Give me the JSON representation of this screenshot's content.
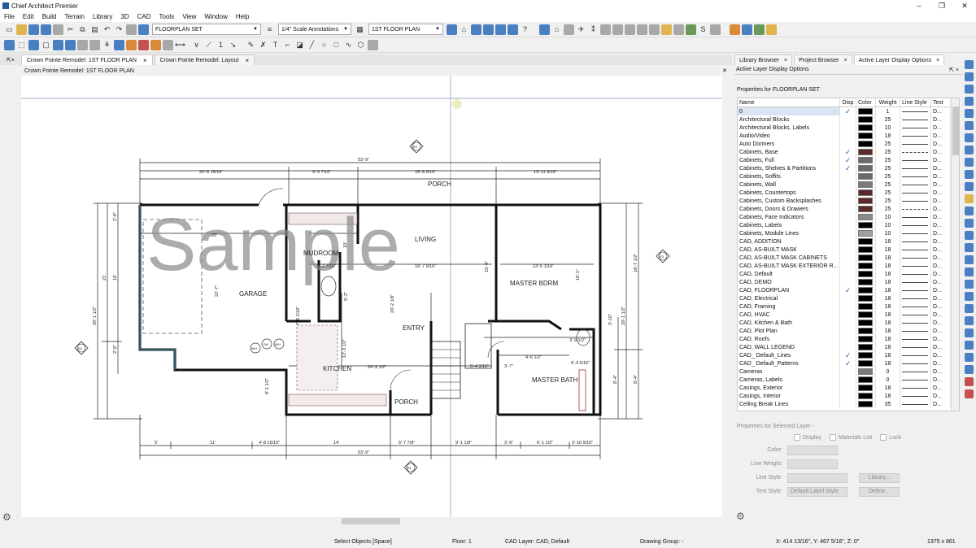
{
  "window": {
    "title": "Chief Architect Premier",
    "controls": [
      "–",
      "❐",
      "✕"
    ]
  },
  "menu": [
    "File",
    "Edit",
    "Build",
    "Terrain",
    "Library",
    "3D",
    "CAD",
    "Tools",
    "View",
    "Window",
    "Help"
  ],
  "toolbar1": {
    "layer_set": "FLOORPLAN SET",
    "annotation_set": "1/4\" Scale Annotations",
    "floor_select": "1ST FLOOR PLAN"
  },
  "toolbar2": {
    "count": "1"
  },
  "tabs": [
    {
      "label": "Crown Pointe Remodel: 1ST FLOOR PLAN",
      "close": "×"
    },
    {
      "label": "Crown Pointe Remodel: Layout",
      "close": "×"
    }
  ],
  "view_title": "Crown Pointe Remodel: 1ST FLOOR PLAN",
  "plan": {
    "rooms": {
      "porch_top": "PORCH",
      "living": "LIVING",
      "mudroom": "MUDROOM",
      "garage": "GARAGE",
      "master_bdrm": "MASTER BDRM",
      "entry": "ENTRY",
      "kitchen": "KITCHEN",
      "porch_bottom": "PORCH",
      "master_bath": "MASTER BATH"
    },
    "dims_top": {
      "overall": "53'-9\"",
      "d1": "20'-8 15/16\"",
      "d2": "9'-3 7/16\"",
      "d3": "18'-8 9/16\"",
      "d4": "13'-11 9/16\""
    },
    "dims_bottom": {
      "overall": "53'-9\"",
      "b1": "5'",
      "b2": "11'",
      "b3": "4'-8 15/16\"",
      "b4": "14'",
      "b5": "5'-7 7/8\"",
      "b6": "9'-1 1/8\"",
      "b7": "3'-9\"",
      "b8": "6'-1 1/2\"",
      "b9": "3'-10 9/16\""
    },
    "dims_inner": {
      "garage_w": "20'",
      "mudroom_w": "9'-2 7/16\"",
      "living_w": "18'-7 9/16\"",
      "master_w": "13'-5 1/16\"",
      "kitchen_w": "24'-3 1/2\"",
      "entry_w": "5'-4 3/16\"",
      "bath_w": "3'-7\"",
      "bath_w2": "4'-6 1/2\"",
      "mb_w": "5'-4 5/16\"",
      "hall_w": "3'-9 1/2\""
    },
    "dims_side": {
      "left": "29'-1 1/2\"",
      "left2": "21'",
      "left3": "16'",
      "right": "29'-1 1/2\"",
      "right2": "16'-7 1/2\"",
      "right3": "8'-4\"",
      "right4": "8'-4\"",
      "left_small1": "2'-8\"",
      "left_small2": "2'-6\"",
      "left_small3": "8'-1 1/2\"",
      "living_h": "20'-2 1/8\"",
      "kitchen_h": "12'-3 1/2\"",
      "garage_h": "22'-7\"",
      "mud_h": "10'",
      "mud_h2": "7'-5 1/16\"",
      "mud_h3": "5'-2\"",
      "mb_h": "16'-1\"",
      "mb_h2": "15'-8\"",
      "bath_h": "3'-10\""
    },
    "markers": [
      "E2",
      "E3",
      "E4",
      "E1"
    ],
    "appliances": [
      "DW",
      "W/H",
      "W/H"
    ],
    "watermark": "Sample"
  },
  "panel": {
    "tabs": [
      {
        "label": "Library Browser",
        "close": "×"
      },
      {
        "label": "Project Browser",
        "close": "×"
      },
      {
        "label": "Active Layer Display Options",
        "close": "×"
      }
    ],
    "header": "Active Layer Display Options",
    "header_ctl": "⇱ ×",
    "props_title": "Properties for FLOORPLAN SET",
    "columns": [
      "Name",
      "Disp",
      "Color",
      "Weight",
      "Line Style",
      "Text"
    ],
    "rows": [
      {
        "name": "0",
        "disp": true,
        "color": "#000000",
        "weight": "1",
        "dash": false
      },
      {
        "name": "Architectural Blocks",
        "disp": false,
        "color": "#000000",
        "weight": "25",
        "dash": false
      },
      {
        "name": "Architectural Blocks, Labels",
        "disp": false,
        "color": "#000000",
        "weight": "10",
        "dash": false
      },
      {
        "name": "Audio/Video",
        "disp": false,
        "color": "#000000",
        "weight": "18",
        "dash": false
      },
      {
        "name": "Auto Dormers",
        "disp": false,
        "color": "#000000",
        "weight": "25",
        "dash": false
      },
      {
        "name": "Cabinets,  Base",
        "disp": true,
        "color": "#5a2a2a",
        "weight": "25",
        "dash": true
      },
      {
        "name": "Cabinets,  Full",
        "disp": true,
        "color": "#6a6a6a",
        "weight": "25",
        "dash": false
      },
      {
        "name": "Cabinets,  Shelves & Partitions",
        "disp": true,
        "color": "#6a6a6a",
        "weight": "25",
        "dash": false
      },
      {
        "name": "Cabinets,  Soffits",
        "disp": false,
        "color": "#6a6a6a",
        "weight": "25",
        "dash": false
      },
      {
        "name": "Cabinets,  Wall",
        "disp": false,
        "color": "#7a7a7a",
        "weight": "25",
        "dash": false
      },
      {
        "name": "Cabinets, Countertops",
        "disp": false,
        "color": "#5a2a2a",
        "weight": "25",
        "dash": false
      },
      {
        "name": "Cabinets, Custom Backsplashes",
        "disp": false,
        "color": "#5a2a2a",
        "weight": "25",
        "dash": false
      },
      {
        "name": "Cabinets, Doors & Drawers",
        "disp": false,
        "color": "#5a2a2a",
        "weight": "25",
        "dash": true
      },
      {
        "name": "Cabinets, Face Indicators",
        "disp": false,
        "color": "#8a8a8a",
        "weight": "10",
        "dash": false
      },
      {
        "name": "Cabinets, Labels",
        "disp": false,
        "color": "#000000",
        "weight": "10",
        "dash": false
      },
      {
        "name": "Cabinets, Module Lines",
        "disp": false,
        "color": "#a0a0a0",
        "weight": "10",
        "dash": false
      },
      {
        "name": "CAD,  ADDITION",
        "disp": false,
        "color": "#000000",
        "weight": "18",
        "dash": false
      },
      {
        "name": "CAD,  AS-BUILT MASK",
        "disp": false,
        "color": "#000000",
        "weight": "18",
        "dash": false
      },
      {
        "name": "CAD,  AS-BUILT MASK CABINETS",
        "disp": false,
        "color": "#000000",
        "weight": "18",
        "dash": false
      },
      {
        "name": "CAD,  AS-BUILT MASK EXTERIOR R...",
        "disp": false,
        "color": "#000000",
        "weight": "18",
        "dash": false
      },
      {
        "name": "CAD,  Default",
        "disp": false,
        "color": "#000000",
        "weight": "18",
        "dash": false
      },
      {
        "name": "CAD,  DEMO",
        "disp": false,
        "color": "#000000",
        "weight": "18",
        "dash": false
      },
      {
        "name": "CAD,  FLOORPLAN",
        "disp": true,
        "color": "#000000",
        "weight": "18",
        "dash": false
      },
      {
        "name": "CAD, Electrical",
        "disp": false,
        "color": "#000000",
        "weight": "18",
        "dash": false
      },
      {
        "name": "CAD, Framing",
        "disp": false,
        "color": "#000000",
        "weight": "18",
        "dash": false
      },
      {
        "name": "CAD, HVAC",
        "disp": false,
        "color": "#000000",
        "weight": "18",
        "dash": false
      },
      {
        "name": "CAD, Kitchen & Bath",
        "disp": false,
        "color": "#000000",
        "weight": "18",
        "dash": false
      },
      {
        "name": "CAD, Plot Plan",
        "disp": false,
        "color": "#000000",
        "weight": "18",
        "dash": false
      },
      {
        "name": "CAD, Roofs",
        "disp": false,
        "color": "#000000",
        "weight": "18",
        "dash": false
      },
      {
        "name": "CAD, WALL LEGEND",
        "disp": false,
        "color": "#000000",
        "weight": "18",
        "dash": false
      },
      {
        "name": "CAD_  Default_Lines",
        "disp": true,
        "color": "#000000",
        "weight": "18",
        "dash": false
      },
      {
        "name": "CAD_  Default_Patterns",
        "disp": true,
        "color": "#000000",
        "weight": "18",
        "dash": false
      },
      {
        "name": "Cameras",
        "disp": false,
        "color": "#7a7a7a",
        "weight": "0",
        "dash": false
      },
      {
        "name": "Cameras, Labels",
        "disp": false,
        "color": "#000000",
        "weight": "0",
        "dash": false
      },
      {
        "name": "Casings, Exterior",
        "disp": false,
        "color": "#000000",
        "weight": "18",
        "dash": false
      },
      {
        "name": "Casings, Interior",
        "disp": false,
        "color": "#000000",
        "weight": "18",
        "dash": false
      },
      {
        "name": "Ceiling Break Lines",
        "disp": false,
        "color": "#000000",
        "weight": "35",
        "dash": false
      }
    ],
    "text_value": "D...",
    "selected": {
      "title": "Properties for Selected Layer -",
      "display": "Display",
      "materials": "Materials List",
      "lock": "Lock",
      "color_lbl": "Color:",
      "weight_lbl": "Line Weight:",
      "style_lbl": "Line Style:",
      "library_btn": "Library...",
      "textstyle_lbl": "Text Style:",
      "textstyle_val": "Default Label Style",
      "define_btn": "Define..."
    }
  },
  "status": {
    "mode": "Select Objects [Space]",
    "floor": "Floor: 1",
    "layer": "CAD Layer: CAD, Default",
    "group": "Drawing Group: -",
    "coords": "X: 414 13/16\", Y: 467 5/16\", Z: 0\"",
    "size": "1375 x 861"
  }
}
